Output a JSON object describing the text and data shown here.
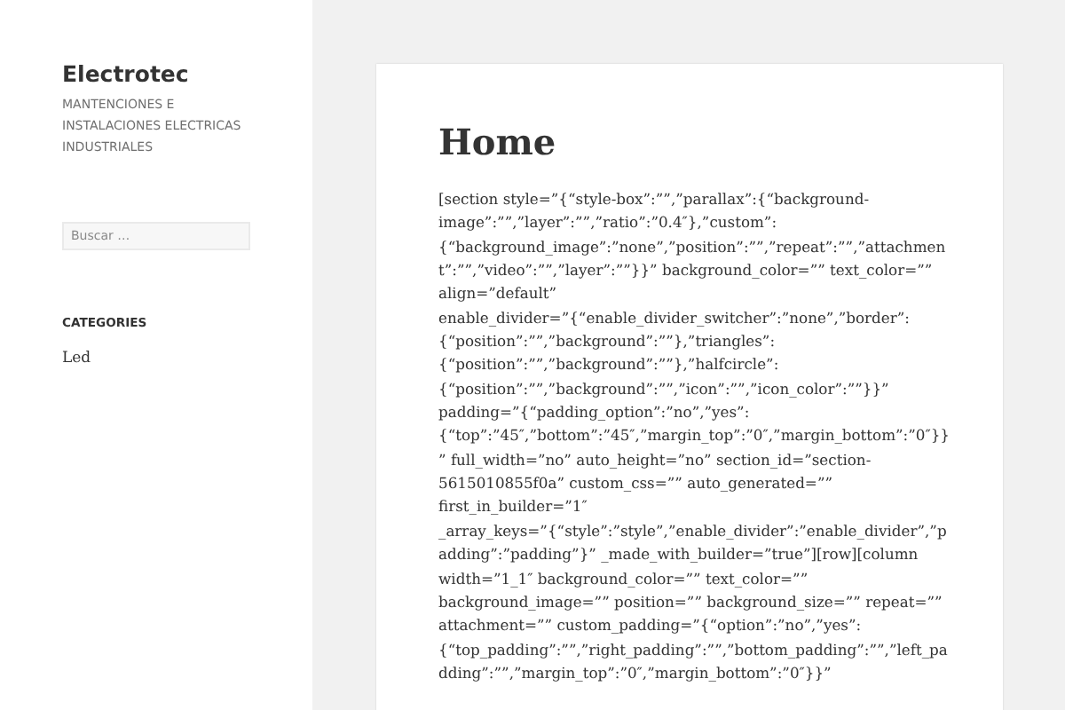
{
  "site": {
    "title": "Electrotec",
    "tagline": "MANTENCIONES E INSTALACIONES ELECTRICAS INDUSTRIALES"
  },
  "search": {
    "placeholder": "Buscar …"
  },
  "categories": {
    "heading": "CATEGORIES",
    "items": [
      "Led"
    ]
  },
  "post": {
    "title": "Home",
    "body": "[section style=”{“style-box”:””,”parallax”:{“background-\nimage”:””,”layer”:””,”ratio”:”0.4″},”custom”:\n{“background_image”:”none”,”position”:””,”repeat”:””,”attachmen\nt”:””,”video”:””,”layer”:””}}” background_color=”” text_color=””\nalign=”default”\nenable_divider=”{“enable_divider_switcher”:”none”,”border”:\n{“position”:””,”background”:””},”triangles”:\n{“position”:””,”background”:””},”halfcircle”:\n{“position”:””,”background”:””,”icon”:””,”icon_color”:””}}”\npadding=”{“padding_option”:”no”,”yes”:\n{“top”:”45″,”bottom”:”45″,”margin_top”:”0″,”margin_bottom”:”0″}}\n” full_width=”no” auto_height=”no” section_id=”section-\n5615010855f0a” custom_css=”” auto_generated=””\nfirst_in_builder=”1″\n_array_keys=”{“style”:”style”,”enable_divider”:”enable_divider”,”p\nadding”:”padding”}” _made_with_builder=”true”][row][column\nwidth=”1_1″ background_color=”” text_color=””\nbackground_image=”” position=”” background_size=”” repeat=””\nattachment=”” custom_padding=”{“option”:”no”,”yes”:\n{“top_padding”:””,”right_padding”:””,”bottom_padding”:””,”left_pa\ndding”:””,”margin_top”:”0″,”margin_bottom”:”0″}}”"
  }
}
